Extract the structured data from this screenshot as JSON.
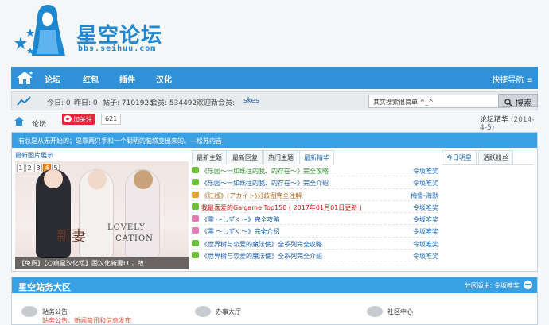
{
  "logo": {
    "title": "星空论坛",
    "url": "bbs.seihuu.com"
  },
  "nav": {
    "items": [
      "论坛",
      "红包",
      "插件",
      "汉化"
    ],
    "quick": "快捷导航 ≡"
  },
  "stats": {
    "today": "今日: 0",
    "yesterday": "昨日: 0",
    "posts": "帖子: 7101925",
    "members": "会员: 534492",
    "welcome": "欢迎新会员:",
    "new_member": "skes",
    "search_value": "其实搜索很简单 ^_^",
    "search_button": "搜索"
  },
  "crumb": {
    "forum": "论坛",
    "follow": "加关注",
    "follow_count": "621",
    "essence": "论坛精华",
    "essence_date": "(2014-4-5)"
  },
  "notice": "有总是从无开始的；是靠两只手和一个聪明的脑袋变出来的。—松苏内吉",
  "pics": {
    "tab": "最新图片展示",
    "nums": [
      "1",
      "2",
      "3",
      "4",
      "5"
    ],
    "active_index": 4,
    "art_text_1": "新妻",
    "art_text_2": "LOVELY",
    "art_text_3": "CATION",
    "caption": "【免费】【心痕星汉化组】困汉化新妻LC，故"
  },
  "tabs": [
    "最新主题",
    "最新回复",
    "热门主题",
    "最新精华"
  ],
  "active_tab": 3,
  "topics": [
    {
      "title": "《乐园～一如既往的我、的存在～》完全攻略",
      "author": "令坂唯奖",
      "color": "#2e8b2e",
      "icon": "#6cbf3a"
    },
    {
      "title": "《乐园～一如既往的我、的存在～》完全介绍",
      "author": "令坂唯奖",
      "color": "#1a5ea8",
      "icon": "#6cbf3a"
    },
    {
      "title": "《红线》(アカイト)分歧图完全注解",
      "author": "梅鲁-海默",
      "color": "#b0661a",
      "icon": "#e6a23a"
    },
    {
      "title": "我最喜爱的Galgame Top150 ( 2017年01月01日更新 )",
      "author": "令坂唯奖",
      "color": "#d01010",
      "icon": "#6cbf3a"
    },
    {
      "title": "《零 ～しずく～》完全攻略",
      "author": "令坂唯奖",
      "color": "#1a5ea8",
      "icon": "#e07ab0"
    },
    {
      "title": "《零 ～しずく～》完全介绍",
      "author": "令坂唯奖",
      "color": "#1a5ea8",
      "icon": "#e07ab0"
    },
    {
      "title": "《世界树与恋爱的魔法使》全系列完全攻略",
      "author": "令坂唯奖",
      "color": "#1a5ea8",
      "icon": "#6cbf3a"
    },
    {
      "title": "《世界树与恋爱的魔法使》全系列完全介绍",
      "author": "令坂唯奖",
      "color": "#1a5ea8",
      "icon": "#6cbf3a"
    }
  ],
  "rtabs": [
    "今日明星",
    "活跃粉丝"
  ],
  "section": {
    "title": "星空站务大区",
    "moderator": "分区版主: 令坂唯奖",
    "forums": [
      {
        "name": "站务公告",
        "desc": "站务公告、新闻简讯和信息发布"
      },
      {
        "name": "办事大厅",
        "desc": ""
      },
      {
        "name": "社区中心",
        "desc": ""
      }
    ]
  },
  "colors": {
    "nav_blue": "#2f91d8",
    "bar_blue": "#3aa0e4",
    "brand": "#1e88d0"
  }
}
